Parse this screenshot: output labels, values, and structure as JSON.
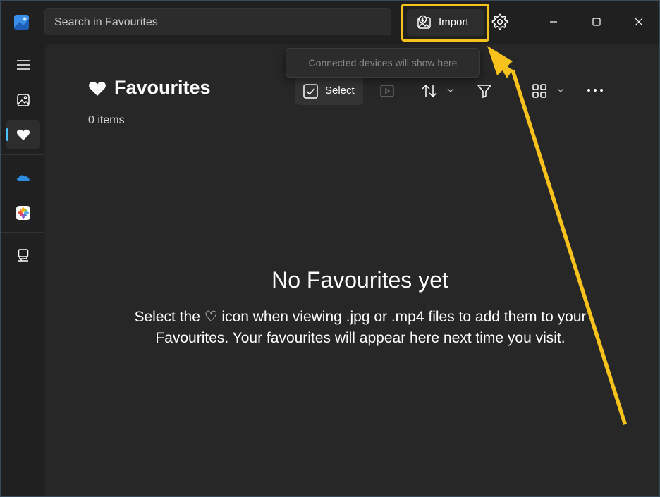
{
  "search": {
    "placeholder": "Search in Favourites"
  },
  "toolbar": {
    "import_label": "Import"
  },
  "tooltip": {
    "text": "Connected devices will show here"
  },
  "page": {
    "title": "Favourites",
    "item_count": "0 items"
  },
  "actions": {
    "select_label": "Select"
  },
  "empty_state": {
    "title": "No Favourites yet",
    "description": "Select the ♡ icon when viewing .jpg or .mp4 files to add them to your Favourites. Your favourites will appear here next time you visit."
  },
  "sidebar": {
    "items": [
      {
        "icon": "hamburger-menu-icon"
      },
      {
        "icon": "gallery-icon"
      },
      {
        "icon": "heart-icon",
        "active": true
      },
      {
        "icon": "onedrive-cloud-icon"
      },
      {
        "icon": "icloud-photos-icon"
      },
      {
        "icon": "this-pc-icon"
      }
    ]
  },
  "colors": {
    "accent": "#4cc2ff",
    "annotation": "#f8c21c",
    "background": "#202020",
    "content_background": "#272727"
  }
}
